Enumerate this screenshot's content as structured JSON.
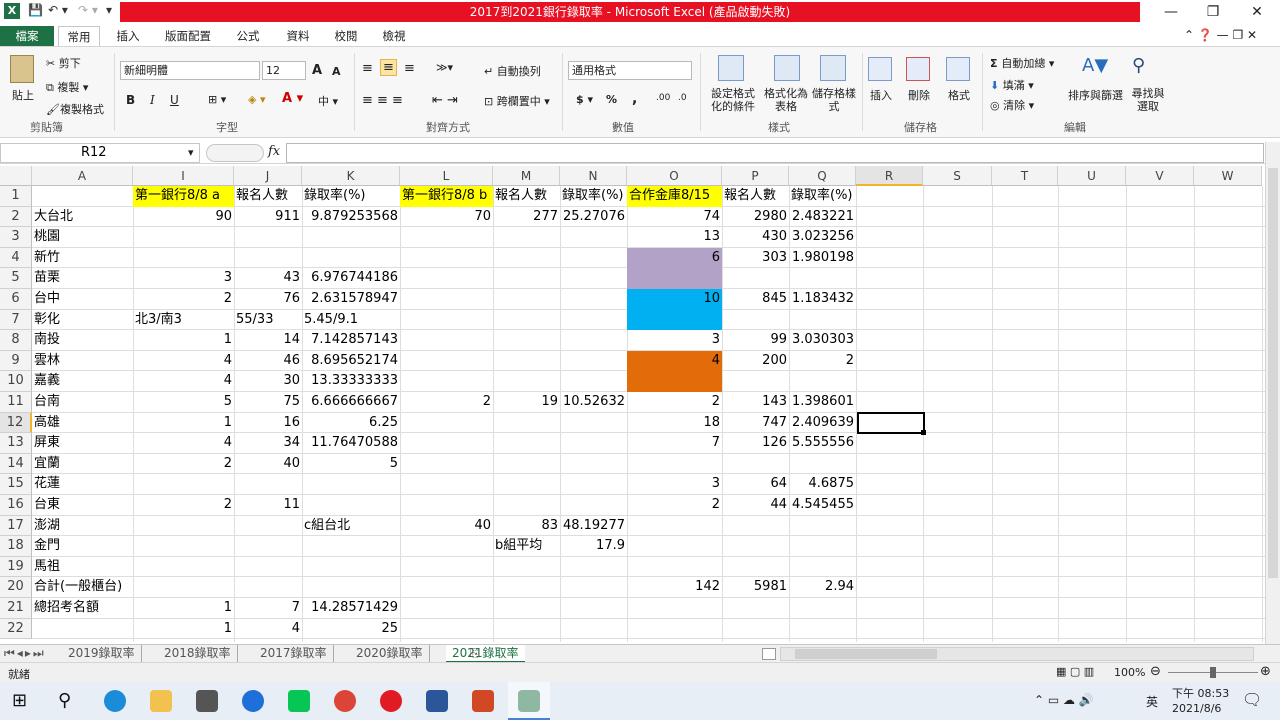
{
  "window": {
    "title": "2017到2021銀行錄取率 - Microsoft Excel (產品啟動失敗)",
    "excel_icon": "excel-icon",
    "qa_save": "save-icon",
    "qa_undo": "undo-icon",
    "qa_redo": "redo-icon",
    "minimize": "—",
    "restore": "❐",
    "close": "✕"
  },
  "tabs": [
    "檔案",
    "常用",
    "插入",
    "版面配置",
    "公式",
    "資料",
    "校閱",
    "檢視"
  ],
  "ribbon": {
    "clipboard": {
      "paste": "貼上",
      "cut": "剪下",
      "copy": "複製",
      "format_painter": "複製格式",
      "group": "剪貼簿"
    },
    "font": {
      "name": "新細明體",
      "size": "12",
      "grow": "A",
      "shrink": "A",
      "bold": "B",
      "italic": "I",
      "underline": "U",
      "phonetic": "中",
      "group": "字型"
    },
    "alignment": {
      "wrap": "自動換列",
      "merge": "跨欄置中",
      "group": "對齊方式"
    },
    "number": {
      "format": "通用格式",
      "currency": "$",
      "percent": "%",
      "comma": ",",
      "inc": ".00",
      "dec": ".0",
      "group": "數值"
    },
    "styles": {
      "cond": "設定格式化的條件",
      "table": "格式化為表格",
      "cell": "儲存格樣式",
      "group": "樣式"
    },
    "cells": {
      "insert": "插入",
      "delete": "刪除",
      "format": "格式",
      "group": "儲存格"
    },
    "editing": {
      "autosum": "自動加總",
      "fill": "填滿",
      "clear": "清除",
      "sort": "排序與篩選",
      "find": "尋找與選取",
      "group": "編輯"
    }
  },
  "formula_bar": {
    "name_box": "R12",
    "fx": "fx",
    "formula": ""
  },
  "columns": [
    "A",
    "I",
    "J",
    "K",
    "L",
    "M",
    "N",
    "O",
    "P",
    "Q",
    "R",
    "S",
    "T",
    "U",
    "V",
    "W"
  ],
  "rows": [
    [
      "",
      "第一銀行8/8 a",
      "報名人數",
      "錄取率(%)",
      "第一銀行8/8 b",
      "報名人數",
      "錄取率(%)",
      "合作金庫8/15",
      "報名人數",
      "錄取率(%)"
    ],
    [
      "大台北",
      "90",
      "911",
      "9.879253568",
      "70",
      "277",
      "25.27076",
      "74",
      "2980",
      "2.483221"
    ],
    [
      "桃園",
      "",
      "",
      "",
      "",
      "",
      "",
      "13",
      "430",
      "3.023256"
    ],
    [
      "新竹",
      "",
      "",
      "",
      "",
      "",
      "",
      "6",
      "303",
      "1.980198"
    ],
    [
      "苗栗",
      "3",
      "43",
      "6.976744186",
      "",
      "",
      "",
      "",
      "",
      ""
    ],
    [
      "台中",
      "2",
      "76",
      "2.631578947",
      "",
      "",
      "",
      "10",
      "845",
      "1.183432"
    ],
    [
      "彰化",
      "北3/南3",
      "55/33",
      "5.45/9.1",
      "",
      "",
      "",
      "",
      "",
      ""
    ],
    [
      "南投",
      "1",
      "14",
      "7.142857143",
      "",
      "",
      "",
      "3",
      "99",
      "3.030303"
    ],
    [
      "雲林",
      "4",
      "46",
      "8.695652174",
      "",
      "",
      "",
      "4",
      "200",
      "2"
    ],
    [
      "嘉義",
      "4",
      "30",
      "13.33333333",
      "",
      "",
      "",
      "",
      "",
      ""
    ],
    [
      "台南",
      "5",
      "75",
      "6.666666667",
      "2",
      "19",
      "10.52632",
      "2",
      "143",
      "1.398601"
    ],
    [
      "高雄",
      "1",
      "16",
      "6.25",
      "",
      "",
      "",
      "18",
      "747",
      "2.409639"
    ],
    [
      "屏東",
      "4",
      "34",
      "11.76470588",
      "",
      "",
      "",
      "7",
      "126",
      "5.555556"
    ],
    [
      "宜蘭",
      "2",
      "40",
      "5",
      "",
      "",
      "",
      "",
      "",
      ""
    ],
    [
      "花蓮",
      "",
      "",
      "",
      "",
      "",
      "",
      "3",
      "64",
      "4.6875"
    ],
    [
      "台東",
      "2",
      "11",
      "",
      "",
      "",
      "",
      "2",
      "44",
      "4.545455"
    ],
    [
      "澎湖",
      "",
      "",
      "c組台北",
      "40",
      "83",
      "48.19277",
      "",
      "",
      ""
    ],
    [
      "金門",
      "",
      "",
      "",
      "",
      "b組平均",
      "17.9",
      "",
      "",
      ""
    ],
    [
      "馬祖",
      "",
      "",
      "",
      "",
      "",
      "",
      "",
      "",
      ""
    ],
    [
      "合計(一般櫃台)",
      "",
      "",
      "",
      "",
      "",
      "",
      "142",
      "5981",
      "2.94"
    ],
    [
      "總招考名額",
      "1",
      "7",
      "14.28571429",
      "",
      "",
      "",
      "",
      "",
      ""
    ],
    [
      "",
      "1",
      "4",
      "25",
      "",
      "",
      "",
      "",
      "",
      ""
    ]
  ],
  "row_numbers": [
    "1",
    "2",
    "3",
    "4",
    "5",
    "6",
    "7",
    "8",
    "9",
    "10",
    "11",
    "12",
    "13",
    "14",
    "15",
    "16",
    "17",
    "18",
    "19",
    "20",
    "21",
    "22"
  ],
  "sheet_tabs": [
    "2019錄取率",
    "2018錄取率",
    "2017錄取率",
    "2020錄取率",
    "2021錄取率"
  ],
  "active_sheet": "2021錄取率",
  "status": {
    "ready": "就緒",
    "zoom": "100%"
  },
  "taskbar": {
    "ime": "英",
    "time": "下午 08:53",
    "date": "2021/8/6"
  },
  "colors": {
    "yellow": "#ffff00",
    "purple": "#b3a2c7",
    "blue": "#00b0f0",
    "orange": "#e26b0a",
    "excel_green": "#1e7145",
    "title_red": "#e81123"
  }
}
